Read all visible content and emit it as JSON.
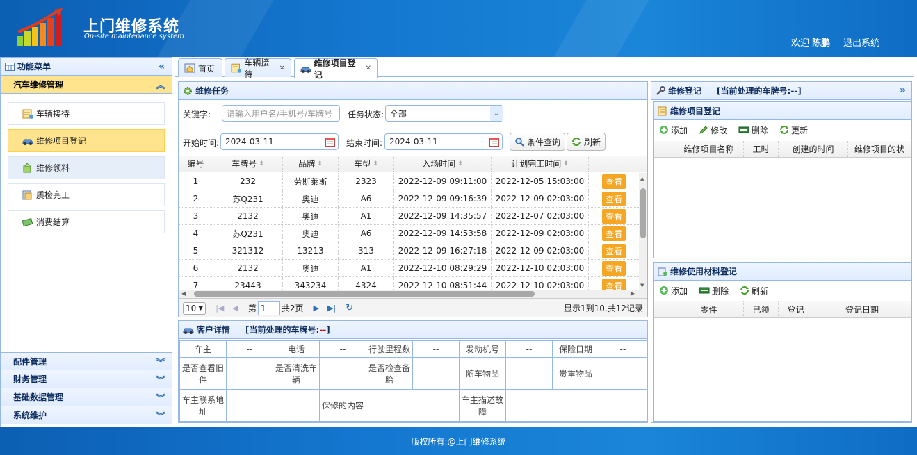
{
  "header": {
    "title": "上门维修系统",
    "subtitle": "On-site maintenance system",
    "welcome_prefix": "欢迎",
    "user": "陈鹏",
    "logout": "退出系统"
  },
  "sidebar": {
    "title": "功能菜单",
    "active_section": "汽车维修管理",
    "items": [
      {
        "label": "车辆接待",
        "icon": "form-icon"
      },
      {
        "label": "维修项目登记",
        "icon": "car-icon"
      },
      {
        "label": "维修领料",
        "icon": "material-icon"
      },
      {
        "label": "质检完工",
        "icon": "inspect-icon"
      },
      {
        "label": "消费结算",
        "icon": "money-icon"
      }
    ],
    "sections": [
      "配件管理",
      "财务管理",
      "基础数据管理",
      "系统维护"
    ]
  },
  "tabs": [
    {
      "label": "首页"
    },
    {
      "label": "车辆接待"
    },
    {
      "label": "维修项目登记"
    }
  ],
  "task": {
    "title": "维修任务",
    "keyword_label": "关键字:",
    "keyword_placeholder": "请输入用户名/手机号/车牌号",
    "status_label": "任务状态:",
    "status_value": "全部",
    "start_label": "开始时间:",
    "start_value": "2024-03-11",
    "end_label": "结束时间:",
    "end_value": "2024-03-11",
    "query_btn": "条件查询",
    "refresh_btn": "刷新",
    "columns": [
      "编号",
      "车牌号",
      "品牌",
      "车型",
      "入场时间",
      "计划完工时间"
    ],
    "view_label": "查看",
    "rows": [
      [
        "1",
        "232",
        "劳斯莱斯",
        "2323",
        "2022-12-09 09:11:00",
        "2022-12-05 15:03:00"
      ],
      [
        "2",
        "苏Q231",
        "奥迪",
        "A6",
        "2022-12-09 09:16:39",
        "2022-12-09 02:03:00"
      ],
      [
        "3",
        "2132",
        "奥迪",
        "A1",
        "2022-12-09 14:35:57",
        "2022-12-07 02:03:00"
      ],
      [
        "4",
        "苏Q231",
        "奥迪",
        "A6",
        "2022-12-09 14:53:58",
        "2022-12-09 02:03:00"
      ],
      [
        "5",
        "321312",
        "13213",
        "313",
        "2022-12-09 16:27:18",
        "2022-12-09 02:03:00"
      ],
      [
        "6",
        "2132",
        "奥迪",
        "A1",
        "2022-12-10 08:29:29",
        "2022-12-10 02:03:00"
      ],
      [
        "7",
        "23443",
        "343234",
        "4324",
        "2022-12-10 08:51:44",
        "2022-12-10 02:03:00"
      ]
    ],
    "page_size": "10",
    "page_prefix": "第",
    "page_current": "1",
    "page_total": "共2页",
    "summary": "显示1到10,共12记录"
  },
  "customer": {
    "title": "客户详情",
    "plate_label": "[当前处理的车牌号:",
    "plate_value": "--",
    "plate_close": "]",
    "fields": {
      "owner": "车主",
      "phone": "电话",
      "mileage": "行驶里程数",
      "engine": "发动机号",
      "insurance": "保险日期",
      "old_parts": "是否查看旧件",
      "wash": "是否清洗车辆",
      "spare": "是否检查备胎",
      "belongings": "随车物品",
      "valuables": "贵重物品",
      "address": "车主联系地址",
      "content": "保修的内容",
      "fault": "车主描述故障"
    },
    "empty": "--"
  },
  "register": {
    "title": "维修登记",
    "plate_label": "[当前处理的车牌号:",
    "plate_value": "--",
    "plate_close": "]",
    "items_title": "维修项目登记",
    "add": "添加",
    "edit": "修改",
    "delete": "删除",
    "update": "更新",
    "columns": [
      "维修项目名称",
      "工时",
      "创建的时间",
      "维修项目的状"
    ],
    "materials_title": "维修使用材料登记",
    "m_add": "添加",
    "m_delete": "删除",
    "m_refresh": "刷新",
    "m_columns": [
      "零件",
      "已领",
      "登记",
      "登记日期"
    ]
  },
  "footer": {
    "text": "版权所有:@上门维修系统"
  }
}
